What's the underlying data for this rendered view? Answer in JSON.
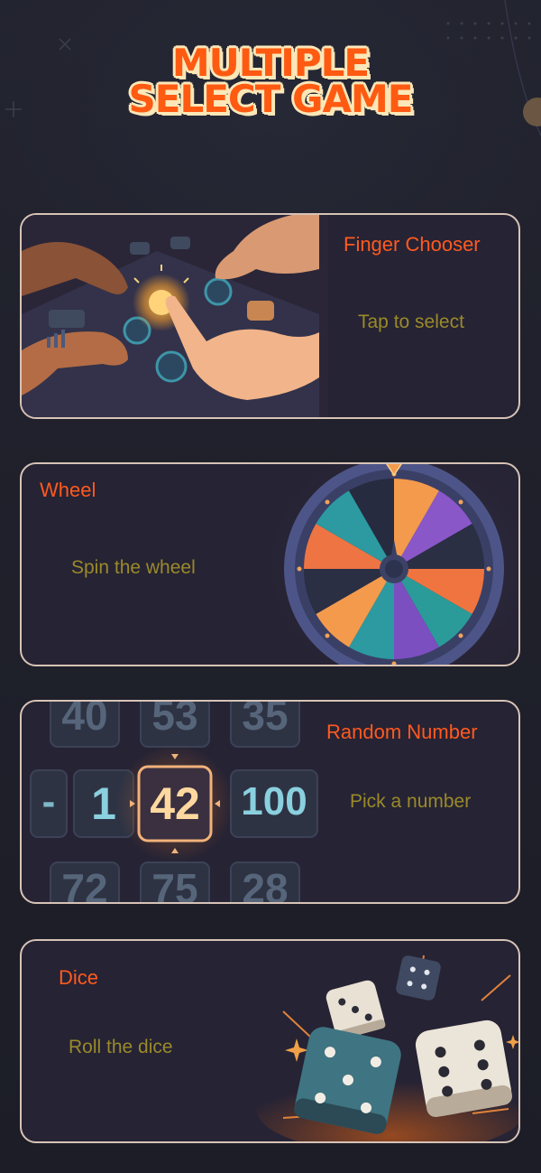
{
  "header": {
    "title_line1": "MULTIPLE",
    "title_line2": "SELECT GAME"
  },
  "colors": {
    "background": "#1e1f29",
    "title_fill": "#ff5a12",
    "title_outline": "#fbe7b8",
    "card_border": "#d7c3b6",
    "card_title": "#ff5a1f",
    "card_subtitle": "#9a8a2a"
  },
  "cards": [
    {
      "title": "Finger Chooser",
      "subtitle": "Tap to select",
      "icon": "hands-finger-icon"
    },
    {
      "title": "Wheel",
      "subtitle": "Spin the wheel",
      "icon": "spin-wheel-icon"
    },
    {
      "title": "Random Number",
      "subtitle": "Pick a number",
      "icon": "number-picker-icon",
      "numbers": {
        "top": [
          "40",
          "53",
          "35"
        ],
        "middle": [
          "-",
          "1",
          "42",
          "100"
        ],
        "bottom": [
          "72",
          "75",
          "28"
        ]
      }
    },
    {
      "title": "Dice",
      "subtitle": "Roll the dice",
      "icon": "dice-icon"
    }
  ]
}
